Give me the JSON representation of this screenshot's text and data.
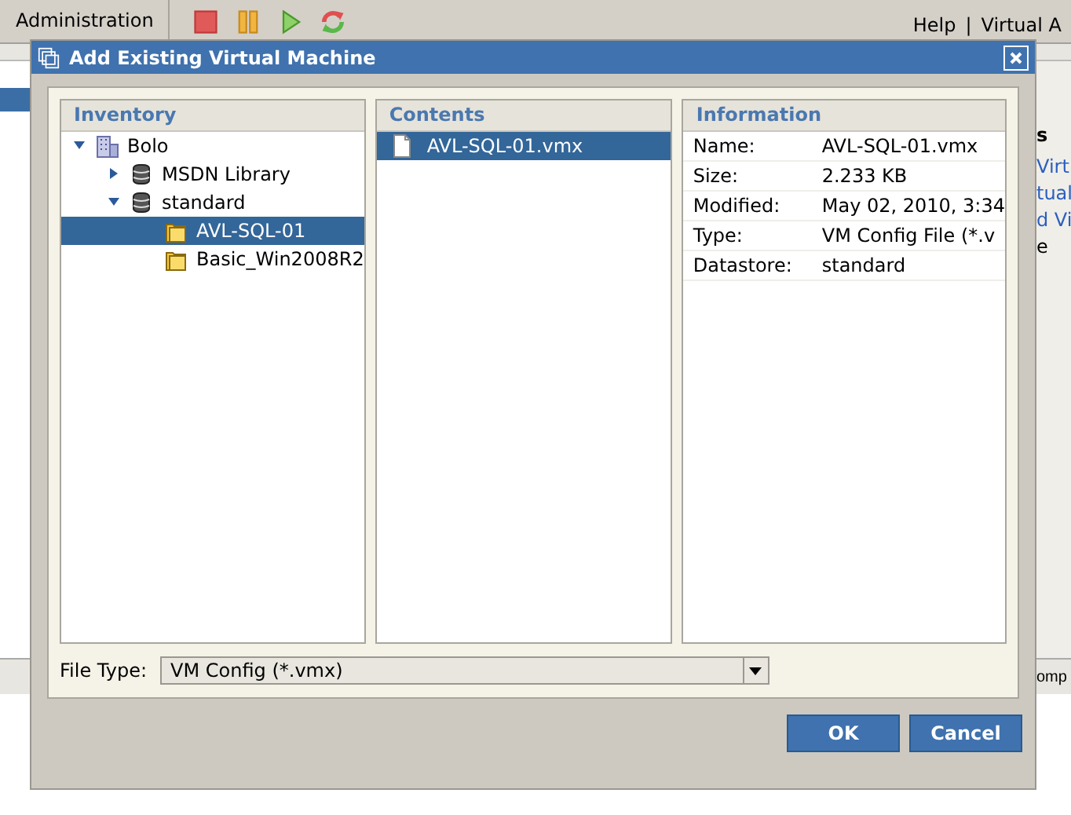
{
  "app": {
    "menu": "Administration",
    "toolbar": [
      {
        "kind": "stop"
      },
      {
        "kind": "pause"
      },
      {
        "kind": "play"
      },
      {
        "kind": "refresh"
      }
    ],
    "links": [
      "Help",
      "|",
      "Virtual A"
    ],
    "behind_panel": {
      "title": "s",
      "items": [
        "Virt",
        "tual",
        "d Vi"
      ],
      "note": "e"
    },
    "behind_status": "omp"
  },
  "dialog": {
    "title": "Add Existing Virtual Machine",
    "inventory": {
      "title": "Inventory",
      "tree": [
        {
          "label": "Bolo",
          "kind": "building",
          "expanded": true,
          "selected": false,
          "children": [
            {
              "label": "MSDN Library",
              "kind": "database",
              "expanded": false,
              "selected": false
            },
            {
              "label": "standard",
              "kind": "database",
              "expanded": true,
              "selected": false,
              "children": [
                {
                  "label": "AVL-SQL-01",
                  "kind": "folder",
                  "selected": true
                },
                {
                  "label": "Basic_Win2008R2",
                  "kind": "folder",
                  "selected": false
                }
              ]
            }
          ]
        }
      ]
    },
    "contents": {
      "title": "Contents",
      "items": [
        {
          "label": "AVL-SQL-01.vmx",
          "selected": true
        }
      ]
    },
    "information": {
      "title": "Information",
      "rows": [
        {
          "label": "Name:",
          "value": "AVL-SQL-01.vmx"
        },
        {
          "label": "Size:",
          "value": "2.233 KB"
        },
        {
          "label": "Modified:",
          "value": "May 02, 2010, 3:34"
        },
        {
          "label": "Type:",
          "value": "VM Config File (*.v"
        },
        {
          "label": "Datastore:",
          "value": "standard"
        }
      ]
    },
    "file_type": {
      "label": "File Type:",
      "value": "VM Config (*.vmx)"
    },
    "buttons": [
      "OK",
      "Cancel"
    ]
  }
}
